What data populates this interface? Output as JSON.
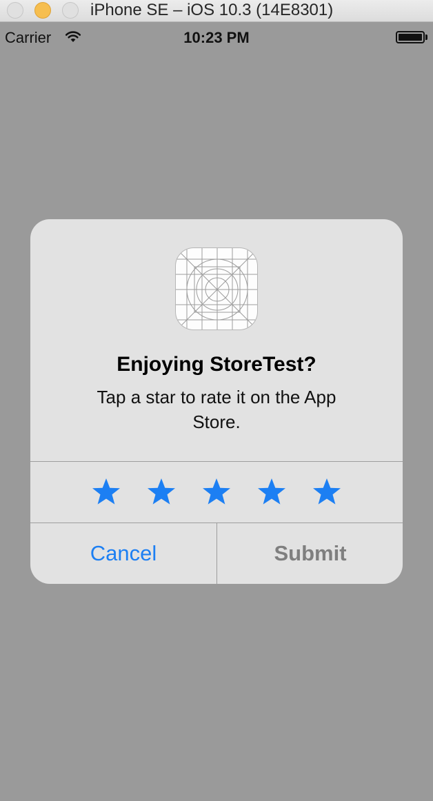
{
  "window": {
    "title": "iPhone SE – iOS 10.3 (14E8301)"
  },
  "status_bar": {
    "carrier": "Carrier",
    "time": "10:23 PM",
    "wifi_icon": "wifi-icon",
    "battery_icon": "battery-icon",
    "battery_level": 1.0
  },
  "alert": {
    "app_icon": "app-icon-placeholder",
    "title": "Enjoying StoreTest?",
    "message": "Tap a star to rate it on the App Store.",
    "star_count": 5,
    "stars_label": "star-icon",
    "cancel_label": "Cancel",
    "submit_label": "Submit"
  },
  "colors": {
    "accent": "#1c7ff3",
    "disabled_text": "#7f7f7f",
    "dimmed_background": "#9a9a9a",
    "alert_background": "#e2e2e2"
  }
}
